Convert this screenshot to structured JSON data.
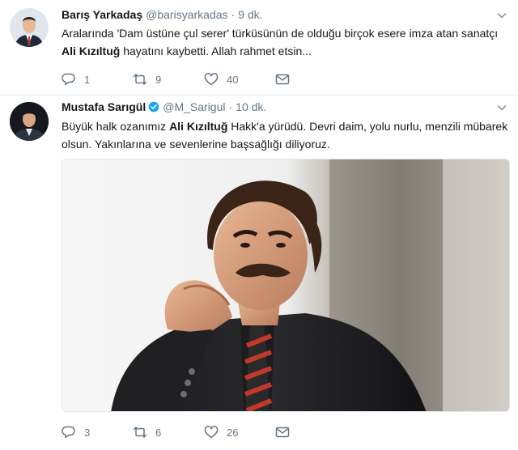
{
  "tweets": [
    {
      "name": "Barış Yarkadaş",
      "handle": "@barisyarkadas",
      "time": "9 dk.",
      "verified": false,
      "text_before": "Aralarında 'Dam üstüne çul serer' türküsünün de olduğu birçok esere imza atan sanatçı ",
      "text_bold": "Ali Kızıltuğ",
      "text_after": " hayatını kaybetti. Allah rahmet etsin...",
      "replies": "1",
      "retweets": "9",
      "likes": "40"
    },
    {
      "name": "Mustafa Sarıgül",
      "handle": "@M_Sarigul",
      "time": "10 dk.",
      "verified": true,
      "text_before": "Büyük halk ozanımız ",
      "text_bold": "Ali Kızıltuğ",
      "text_after": " Hakk'a yürüdü. Devri daim, yolu nurlu, menzili mübarek olsun. Yakınlarına ve sevenlerine başsağlığı diliyoruz.",
      "replies": "3",
      "retweets": "6",
      "likes": "26"
    }
  ],
  "dot": "·",
  "icons": {
    "reply": "reply-icon",
    "retweet": "retweet-icon",
    "like": "heart-icon",
    "dm": "envelope-icon",
    "caret": "chevron-down-icon",
    "verified": "verified-badge-icon"
  },
  "colors": {
    "accent": "#1da1f2",
    "muted": "#657786",
    "text": "#14171a"
  }
}
